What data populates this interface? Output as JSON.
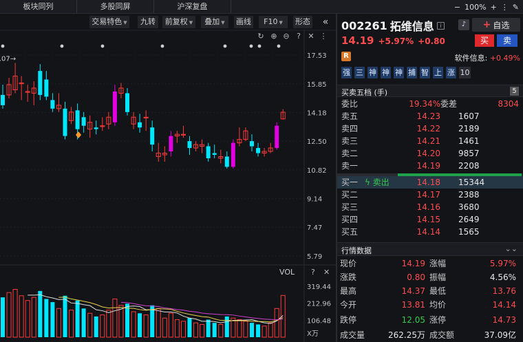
{
  "topbar": {
    "tabs": [
      "板块同列",
      "多股同屏",
      "沪深复盘"
    ],
    "zoom": "100%"
  },
  "toolbar": {
    "buttons": [
      "交易特色",
      "九转",
      "前复权",
      "叠加",
      "画线",
      "F10",
      "形态"
    ]
  },
  "chart": {
    "price_ticks": [
      "17.53",
      "15.85",
      "14.18",
      "12.50",
      "10.82",
      "9.14",
      "7.47",
      "5.79"
    ],
    "high_label": "17.07",
    "vol_label": "VOL",
    "vol_ticks": [
      "319.44",
      "212.96",
      "106.48"
    ],
    "vol_unit": "X万"
  },
  "chart_data": {
    "type": "candlestick",
    "ylim": [
      5.79,
      17.53
    ],
    "candles": [
      {
        "o": 14.6,
        "c": 15.2,
        "h": 15.8,
        "l": 14.4,
        "up": false
      },
      {
        "o": 15.2,
        "c": 15.8,
        "h": 16.2,
        "l": 15.0,
        "up": true
      },
      {
        "o": 15.5,
        "c": 16.3,
        "h": 17.07,
        "l": 15.3,
        "up": true
      },
      {
        "o": 15.9,
        "c": 15.9,
        "h": 16.3,
        "l": 14.9,
        "up": true
      },
      {
        "o": 15.4,
        "c": 15.4,
        "h": 15.8,
        "l": 14.8,
        "up": true
      },
      {
        "o": 15.3,
        "c": 15.6,
        "h": 16.0,
        "l": 14.6,
        "up": true
      },
      {
        "o": 16.6,
        "c": 15.2,
        "h": 17.0,
        "l": 14.9,
        "up": false
      },
      {
        "o": 16.1,
        "c": 15.1,
        "h": 16.6,
        "l": 14.9,
        "up": false
      },
      {
        "o": 14.9,
        "c": 14.4,
        "h": 15.3,
        "l": 14.2,
        "up": false
      },
      {
        "o": 14.6,
        "c": 14.4,
        "h": 15.3,
        "l": 14.2,
        "up": true
      },
      {
        "o": 14.4,
        "c": 12.8,
        "h": 14.8,
        "l": 12.6,
        "up": false
      },
      {
        "o": 13.7,
        "c": 14.2,
        "h": 14.5,
        "l": 13.5,
        "up": true
      },
      {
        "o": 14.3,
        "c": 13.2,
        "h": 14.7,
        "l": 12.6,
        "up": false
      },
      {
        "o": 13.9,
        "c": 13.4,
        "h": 14.2,
        "l": 13.0,
        "up": false
      },
      {
        "o": 13.2,
        "c": 13.6,
        "h": 14.0,
        "l": 12.7,
        "up": true
      },
      {
        "o": 13.3,
        "c": 13.2,
        "h": 13.7,
        "l": 12.9,
        "up": false
      },
      {
        "o": 13.4,
        "c": 13.4,
        "h": 13.9,
        "l": 13.1,
        "up": true
      },
      {
        "o": 13.5,
        "c": 13.9,
        "h": 14.2,
        "l": 13.2,
        "up": true
      },
      {
        "o": 13.6,
        "c": 15.4,
        "h": 15.8,
        "l": 13.4,
        "up": true
      },
      {
        "o": 15.3,
        "c": 15.6,
        "h": 15.9,
        "l": 15.0,
        "up": true
      },
      {
        "o": 15.3,
        "c": 14.2,
        "h": 15.6,
        "l": 14.0,
        "up": false
      },
      {
        "o": 13.9,
        "c": 13.5,
        "h": 14.2,
        "l": 13.2,
        "up": true
      },
      {
        "o": 13.6,
        "c": 13.3,
        "h": 14.1,
        "l": 13.0,
        "up": false
      },
      {
        "o": 13.9,
        "c": 13.9,
        "h": 14.3,
        "l": 13.1,
        "up": true
      },
      {
        "o": 13.3,
        "c": 12.3,
        "h": 13.7,
        "l": 11.9,
        "up": false
      },
      {
        "o": 11.6,
        "c": 11.8,
        "h": 12.4,
        "l": 11.3,
        "up": true
      },
      {
        "o": 11.8,
        "c": 11.7,
        "h": 12.2,
        "l": 11.3,
        "up": true
      },
      {
        "o": 11.9,
        "c": 12.8,
        "h": 13.1,
        "l": 11.6,
        "up": true
      },
      {
        "o": 12.8,
        "c": 12.9,
        "h": 13.1,
        "l": 12.4,
        "up": true
      },
      {
        "o": 12.9,
        "c": 12.9,
        "h": 13.4,
        "l": 12.7,
        "up": true
      },
      {
        "o": 12.5,
        "c": 12.1,
        "h": 12.8,
        "l": 11.7,
        "up": false
      },
      {
        "o": 12.1,
        "c": 12.3,
        "h": 12.5,
        "l": 11.9,
        "up": true
      },
      {
        "o": 12.3,
        "c": 12.2,
        "h": 12.6,
        "l": 11.8,
        "up": true
      },
      {
        "o": 12.2,
        "c": 11.5,
        "h": 12.4,
        "l": 11.3,
        "up": false
      },
      {
        "o": 11.8,
        "c": 11.7,
        "h": 12.3,
        "l": 11.5,
        "up": false
      },
      {
        "o": 11.5,
        "c": 11.6,
        "h": 12.0,
        "l": 11.2,
        "up": true
      },
      {
        "o": 11.6,
        "c": 11.0,
        "h": 11.9,
        "l": 10.9,
        "up": false
      },
      {
        "o": 11.0,
        "c": 12.4,
        "h": 12.6,
        "l": 10.9,
        "up": true
      },
      {
        "o": 12.4,
        "c": 12.6,
        "h": 13.3,
        "l": 12.2,
        "up": true
      },
      {
        "o": 12.6,
        "c": 13.1,
        "h": 13.3,
        "l": 12.5,
        "up": true
      },
      {
        "o": 12.5,
        "c": 12.2,
        "h": 12.9,
        "l": 11.9,
        "up": false
      },
      {
        "o": 12.1,
        "c": 11.8,
        "h": 12.4,
        "l": 11.6,
        "up": false
      },
      {
        "o": 11.8,
        "c": 11.9,
        "h": 12.1,
        "l": 11.6,
        "up": true
      },
      {
        "o": 11.9,
        "c": 12.1,
        "h": 12.4,
        "l": 11.8,
        "up": true
      },
      {
        "o": 12.1,
        "c": 13.4,
        "h": 13.6,
        "l": 12.0,
        "up": true
      },
      {
        "o": 13.8,
        "c": 14.19,
        "h": 14.37,
        "l": 13.76,
        "up": true
      }
    ],
    "volumes": [
      {
        "v": 250,
        "up": false
      },
      {
        "v": 280,
        "up": true
      },
      {
        "v": 300,
        "up": true
      },
      {
        "v": 260,
        "up": true
      },
      {
        "v": 230,
        "up": true
      },
      {
        "v": 250,
        "up": true
      },
      {
        "v": 290,
        "up": false
      },
      {
        "v": 240,
        "up": false
      },
      {
        "v": 220,
        "up": false
      },
      {
        "v": 180,
        "up": true
      },
      {
        "v": 260,
        "up": false
      },
      {
        "v": 170,
        "up": true
      },
      {
        "v": 230,
        "up": false
      },
      {
        "v": 180,
        "up": false
      },
      {
        "v": 150,
        "up": true
      },
      {
        "v": 130,
        "up": false
      },
      {
        "v": 140,
        "up": true
      },
      {
        "v": 170,
        "up": true
      },
      {
        "v": 240,
        "up": true
      },
      {
        "v": 200,
        "up": true
      },
      {
        "v": 210,
        "up": false
      },
      {
        "v": 160,
        "up": true
      },
      {
        "v": 150,
        "up": false
      },
      {
        "v": 140,
        "up": true
      },
      {
        "v": 200,
        "up": false
      },
      {
        "v": 180,
        "up": true
      },
      {
        "v": 120,
        "up": true
      },
      {
        "v": 150,
        "up": true
      },
      {
        "v": 110,
        "up": true
      },
      {
        "v": 100,
        "up": true
      },
      {
        "v": 120,
        "up": false
      },
      {
        "v": 90,
        "up": true
      },
      {
        "v": 80,
        "up": true
      },
      {
        "v": 110,
        "up": false
      },
      {
        "v": 90,
        "up": false
      },
      {
        "v": 80,
        "up": true
      },
      {
        "v": 130,
        "up": false
      },
      {
        "v": 120,
        "up": true
      },
      {
        "v": 110,
        "up": true
      },
      {
        "v": 100,
        "up": true
      },
      {
        "v": 90,
        "up": false
      },
      {
        "v": 80,
        "up": false
      },
      {
        "v": 70,
        "up": true
      },
      {
        "v": 90,
        "up": true
      },
      {
        "v": 180,
        "up": true
      },
      {
        "v": 262,
        "up": true
      }
    ],
    "colors": {
      "up": "#ff3a3a",
      "up_strong": "#e000e0",
      "down": "#00e6ff",
      "ma": "#e0e0e0"
    }
  },
  "stock": {
    "code": "002261",
    "name": "拓维信息",
    "zixuan": "自选",
    "price": "14.19",
    "pct": "+5.97%",
    "chg": "+0.80",
    "buy": "买",
    "sell": "卖"
  },
  "sector": {
    "badge": "R",
    "label": "软件信息:",
    "value": "+0.49%"
  },
  "signals": [
    "强",
    "三",
    "神",
    "神",
    "神",
    "捕",
    "智",
    "上",
    "涨",
    "10"
  ],
  "quote5": {
    "title": "买卖五档 (手)",
    "count": "5",
    "weibi_label": "委比",
    "weibi": "19.34%",
    "weicha_label": "委差",
    "weicha": "8304",
    "asks": [
      {
        "l": "卖五",
        "p": "14.23",
        "v": "1607"
      },
      {
        "l": "卖四",
        "p": "14.22",
        "v": "2189"
      },
      {
        "l": "卖三",
        "p": "14.21",
        "v": "1461"
      },
      {
        "l": "卖二",
        "p": "14.20",
        "v": "9857"
      },
      {
        "l": "卖一",
        "p": "14.19",
        "v": "2208"
      }
    ],
    "bids": [
      {
        "l": "买一",
        "p": "14.18",
        "v": "15344",
        "tag": "卖出"
      },
      {
        "l": "买二",
        "p": "14.17",
        "v": "2388"
      },
      {
        "l": "买三",
        "p": "14.16",
        "v": "3680"
      },
      {
        "l": "买四",
        "p": "14.15",
        "v": "2649"
      },
      {
        "l": "买五",
        "p": "14.14",
        "v": "1565"
      }
    ]
  },
  "market": {
    "title": "行情数据",
    "rows": [
      {
        "a": "现价",
        "b": "14.19",
        "bc": "red",
        "c": "涨幅",
        "d": "5.97%",
        "dc": "red"
      },
      {
        "a": "涨跌",
        "b": "0.80",
        "bc": "red",
        "c": "振幅",
        "d": "4.56%",
        "dc": "wht"
      },
      {
        "a": "最高",
        "b": "14.37",
        "bc": "red",
        "c": "最低",
        "d": "13.76",
        "dc": "red"
      },
      {
        "a": "今开",
        "b": "13.81",
        "bc": "red",
        "c": "均价",
        "d": "14.14",
        "dc": "red"
      },
      {
        "a": "跌停",
        "b": "12.05",
        "bc": "green",
        "c": "涨停",
        "d": "14.73",
        "dc": "red"
      },
      {
        "a": "成交量",
        "b": "262.25万",
        "bc": "wht",
        "c": "成交额",
        "d": "37.09亿",
        "dc": "wht"
      }
    ]
  }
}
